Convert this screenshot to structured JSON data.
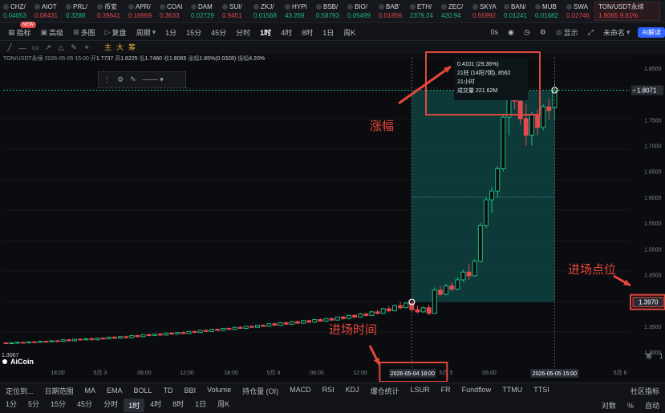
{
  "ticker": [
    {
      "sym": "CHZ/",
      "price": "0.04053",
      "dir": "up"
    },
    {
      "sym": "AIOT",
      "price": "0.08431",
      "dir": "dn"
    },
    {
      "sym": "PRL/",
      "price": "0.3288",
      "dir": "up"
    },
    {
      "sym": "币安",
      "price": "0.39641",
      "dir": "dn"
    },
    {
      "sym": "APR/",
      "price": "0.16969",
      "dir": "dn"
    },
    {
      "sym": "COAI",
      "price": "0.3633",
      "dir": "dn"
    },
    {
      "sym": "DAM",
      "price": "0.02729",
      "dir": "up"
    },
    {
      "sym": "SUI/",
      "price": "0.9451",
      "dir": "dn"
    },
    {
      "sym": "ZKJ/",
      "price": "0.01568",
      "dir": "up"
    },
    {
      "sym": "HYPI",
      "price": "43.269",
      "dir": "up"
    },
    {
      "sym": "BSB/",
      "price": "0.58793",
      "dir": "up"
    },
    {
      "sym": "BIO/",
      "price": "0.05499",
      "dir": "up"
    },
    {
      "sym": "BAB'",
      "price": "0.01856",
      "dir": "dn"
    },
    {
      "sym": "ETH/",
      "price": "2379.24",
      "dir": "up"
    },
    {
      "sym": "ZEC/",
      "price": "420.94",
      "dir": "up"
    },
    {
      "sym": "SKYA",
      "price": "0.55992",
      "dir": "dn"
    },
    {
      "sym": "BAN/",
      "price": "0.01241",
      "dir": "up"
    },
    {
      "sym": "MUB",
      "price": "0.01682",
      "dir": "up"
    },
    {
      "sym": "SWA",
      "price": "0.02746",
      "dir": "dn"
    }
  ],
  "active_ticker": {
    "sym": "TON/USDT永续",
    "price": "1.8065",
    "change": "9.61%"
  },
  "toolbar": {
    "indicator": "指标",
    "advanced": "高级",
    "new_badge": "NEW",
    "multi": "多图",
    "replay": "复盘",
    "period_label": "周期",
    "periods": [
      "1分",
      "15分",
      "45分",
      "分时",
      "1时",
      "4时",
      "8时",
      "1日",
      "周K"
    ],
    "selected_period": "1时",
    "time_display": "0s",
    "display": "显示",
    "account": "未命名",
    "ai": "AI解读"
  },
  "layers": {
    "main": "主",
    "big": "大",
    "fine": "筹"
  },
  "chart_info": {
    "symbol": "TON/USDT永续",
    "time": "2026-05-05 15:00",
    "open_label": "开",
    "open": "1.7737",
    "high_label": "高",
    "high": "1.8225",
    "low_label": "低",
    "low": "1.7480",
    "close_label": "收",
    "close": "1.8065",
    "change_label": "涨幅",
    "change": "1.85%(0.0328)",
    "amp_label": "振幅",
    "amp": "4.20%"
  },
  "tooltip": {
    "line1": "0.4101 (29.36%)",
    "line2": "21柱 (14阳7阴),",
    "line2b": "8562",
    "line3": "21小时",
    "line4": "成交量 221.62M"
  },
  "annotations": {
    "gain": "涨幅",
    "entry_time": "进场时间",
    "entry_point": "进场点位"
  },
  "price_axis": {
    "ticks": [
      "1.8500",
      "1.7500",
      "1.7000",
      "1.6500",
      "1.6000",
      "1.5500",
      "1.5000",
      "1.4500",
      "1.3500",
      "1.3000"
    ],
    "current": "1.8071",
    "entry": "1.3970",
    "low_label": "1.3067"
  },
  "time_axis": {
    "labels": [
      "18:00",
      "5月 3",
      "06:00",
      "12:00",
      "18:00",
      "5月 4",
      "06:00",
      "12:00",
      "5月 5",
      "06:00",
      "5月 6"
    ],
    "entry_time": "2026-05-04 18:00",
    "end_time": "2026-05-05 15:00"
  },
  "axis_corner": {
    "a": "筹",
    "b": "1"
  },
  "logo": "AiCoin",
  "indicators_bar": {
    "locate": "定位到...",
    "date_range": "日期范围",
    "items": [
      "MA",
      "EMA",
      "BOLL",
      "TD",
      "BBI"
    ],
    "sub_items": [
      "Volume",
      "持仓量 (OI)",
      "MACD",
      "RSI",
      "KDJ",
      "爆仓统计",
      "LSUR",
      "FR",
      "Fundflow",
      "TTMU",
      "TTSI"
    ],
    "community": "社区指标",
    "log": "对数",
    "pct": "%",
    "auto": "自动"
  },
  "period_bar": [
    "1分",
    "5分",
    "15分",
    "45分",
    "分时",
    "1时",
    "4时",
    "8时",
    "1日",
    "周K"
  ],
  "colors": {
    "up": "#1fb981",
    "down": "#e5484d",
    "annot": "#e8463c",
    "zone": "#0f4a48"
  },
  "chart_data": {
    "type": "candlestick",
    "ylim": [
      1.28,
      1.87
    ],
    "candles": [
      [
        1.318,
        1.319,
        1.316,
        1.317
      ],
      [
        1.317,
        1.319,
        1.316,
        1.318
      ],
      [
        1.318,
        1.32,
        1.317,
        1.319
      ],
      [
        1.319,
        1.32,
        1.317,
        1.318
      ],
      [
        1.318,
        1.321,
        1.317,
        1.32
      ],
      [
        1.32,
        1.321,
        1.318,
        1.319
      ],
      [
        1.319,
        1.322,
        1.318,
        1.321
      ],
      [
        1.321,
        1.322,
        1.319,
        1.32
      ],
      [
        1.32,
        1.323,
        1.319,
        1.322
      ],
      [
        1.322,
        1.324,
        1.32,
        1.321
      ],
      [
        1.321,
        1.325,
        1.32,
        1.324
      ],
      [
        1.324,
        1.325,
        1.321,
        1.322
      ],
      [
        1.322,
        1.326,
        1.321,
        1.325
      ],
      [
        1.325,
        1.327,
        1.323,
        1.324
      ],
      [
        1.324,
        1.327,
        1.322,
        1.326
      ],
      [
        1.326,
        1.328,
        1.323,
        1.324
      ],
      [
        1.324,
        1.328,
        1.323,
        1.327
      ],
      [
        1.327,
        1.329,
        1.325,
        1.326
      ],
      [
        1.326,
        1.33,
        1.325,
        1.329
      ],
      [
        1.329,
        1.331,
        1.326,
        1.327
      ],
      [
        1.327,
        1.331,
        1.326,
        1.33
      ],
      [
        1.33,
        1.332,
        1.327,
        1.328
      ],
      [
        1.328,
        1.333,
        1.327,
        1.332
      ],
      [
        1.332,
        1.334,
        1.329,
        1.33
      ],
      [
        1.33,
        1.335,
        1.329,
        1.334
      ],
      [
        1.334,
        1.336,
        1.331,
        1.332
      ],
      [
        1.332,
        1.336,
        1.331,
        1.335
      ],
      [
        1.335,
        1.337,
        1.332,
        1.333
      ],
      [
        1.333,
        1.338,
        1.332,
        1.337
      ],
      [
        1.337,
        1.339,
        1.334,
        1.335
      ],
      [
        1.335,
        1.339,
        1.334,
        1.338
      ],
      [
        1.338,
        1.34,
        1.335,
        1.336
      ],
      [
        1.336,
        1.341,
        1.335,
        1.34
      ],
      [
        1.34,
        1.342,
        1.337,
        1.338
      ],
      [
        1.338,
        1.343,
        1.337,
        1.342
      ],
      [
        1.342,
        1.344,
        1.339,
        1.34
      ],
      [
        1.34,
        1.345,
        1.339,
        1.344
      ],
      [
        1.344,
        1.346,
        1.341,
        1.342
      ],
      [
        1.342,
        1.347,
        1.341,
        1.346
      ],
      [
        1.346,
        1.348,
        1.343,
        1.344
      ],
      [
        1.344,
        1.349,
        1.343,
        1.348
      ],
      [
        1.348,
        1.35,
        1.345,
        1.346
      ],
      [
        1.346,
        1.351,
        1.345,
        1.35
      ],
      [
        1.35,
        1.352,
        1.347,
        1.348
      ],
      [
        1.348,
        1.353,
        1.347,
        1.352
      ],
      [
        1.352,
        1.354,
        1.349,
        1.35
      ],
      [
        1.35,
        1.356,
        1.349,
        1.355
      ],
      [
        1.355,
        1.357,
        1.351,
        1.352
      ],
      [
        1.352,
        1.358,
        1.351,
        1.357
      ],
      [
        1.357,
        1.359,
        1.353,
        1.354
      ],
      [
        1.354,
        1.36,
        1.353,
        1.359
      ],
      [
        1.359,
        1.361,
        1.355,
        1.356
      ],
      [
        1.356,
        1.362,
        1.355,
        1.361
      ],
      [
        1.361,
        1.363,
        1.357,
        1.358
      ],
      [
        1.358,
        1.364,
        1.357,
        1.363
      ],
      [
        1.363,
        1.365,
        1.359,
        1.36
      ],
      [
        1.36,
        1.366,
        1.359,
        1.365
      ],
      [
        1.365,
        1.367,
        1.361,
        1.362
      ],
      [
        1.362,
        1.369,
        1.361,
        1.368
      ],
      [
        1.368,
        1.37,
        1.363,
        1.365
      ],
      [
        1.365,
        1.372,
        1.364,
        1.371
      ],
      [
        1.371,
        1.373,
        1.366,
        1.368
      ],
      [
        1.368,
        1.376,
        1.367,
        1.374
      ],
      [
        1.374,
        1.377,
        1.369,
        1.371
      ],
      [
        1.371,
        1.38,
        1.37,
        1.378
      ],
      [
        1.378,
        1.382,
        1.373,
        1.375
      ],
      [
        1.375,
        1.386,
        1.374,
        1.384
      ],
      [
        1.384,
        1.389,
        1.377,
        1.38
      ],
      [
        1.38,
        1.392,
        1.379,
        1.39
      ],
      [
        1.39,
        1.398,
        1.383,
        1.386
      ],
      [
        1.386,
        1.397,
        1.385,
        1.395
      ],
      [
        1.395,
        1.399,
        1.38,
        1.382
      ],
      [
        1.382,
        1.39,
        1.375,
        1.378
      ],
      [
        1.378,
        1.388,
        1.376,
        1.386
      ],
      [
        1.386,
        1.392,
        1.372,
        1.375
      ],
      [
        1.375,
        1.425,
        1.374,
        1.42
      ],
      [
        1.42,
        1.428,
        1.408,
        1.412
      ],
      [
        1.412,
        1.432,
        1.41,
        1.428
      ],
      [
        1.428,
        1.435,
        1.418,
        1.422
      ],
      [
        1.422,
        1.445,
        1.42,
        1.44
      ],
      [
        1.44,
        1.46,
        1.436,
        1.455
      ],
      [
        1.455,
        1.47,
        1.44,
        1.448
      ],
      [
        1.448,
        1.48,
        1.446,
        1.476
      ],
      [
        1.476,
        1.55,
        1.474,
        1.545
      ],
      [
        1.545,
        1.6,
        1.54,
        1.595
      ],
      [
        1.595,
        1.62,
        1.57,
        1.612
      ],
      [
        1.612,
        1.66,
        1.6,
        1.655
      ],
      [
        1.655,
        1.76,
        1.65,
        1.755
      ],
      [
        1.755,
        1.8,
        1.72,
        1.79
      ],
      [
        1.79,
        1.82,
        1.77,
        1.786
      ],
      [
        1.786,
        1.8,
        1.74,
        1.752
      ],
      [
        1.752,
        1.78,
        1.7,
        1.72
      ],
      [
        1.72,
        1.765,
        1.7,
        1.76
      ],
      [
        1.76,
        1.77,
        1.72,
        1.735
      ],
      [
        1.735,
        1.78,
        1.73,
        1.775
      ],
      [
        1.775,
        1.79,
        1.75,
        1.768
      ],
      [
        1.773,
        1.822,
        1.748,
        1.806
      ]
    ]
  }
}
